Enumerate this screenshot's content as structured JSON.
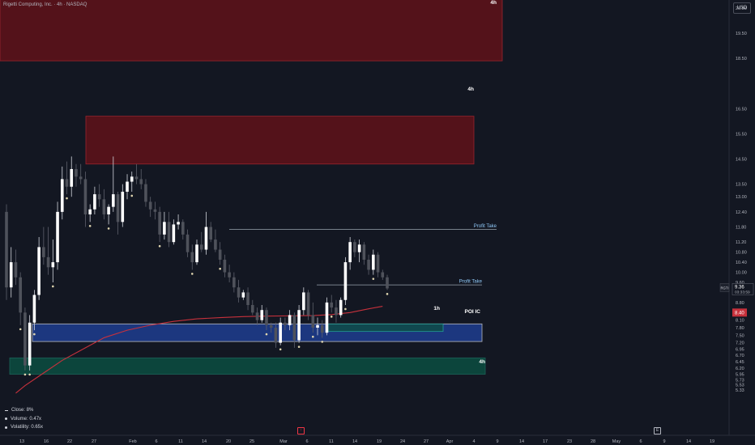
{
  "header": {
    "symbol_line": "Rigetti Computing, Inc. · 4h · NASDAQ",
    "currency_button": "USD"
  },
  "price_axis": {
    "ticks": [
      "20.50",
      "19.50",
      "18.50",
      "16.50",
      "15.50",
      "14.50",
      "13.50",
      "13.00",
      "12.40",
      "11.80",
      "11.20",
      "10.80",
      "10.40",
      "10.00",
      "9.60",
      "8.80",
      "8.40",
      "8.10",
      "7.80",
      "7.50",
      "7.20",
      "6.95",
      "6.70",
      "6.45",
      "6.20",
      "5.95",
      "5.73",
      "5.53",
      "5.33"
    ],
    "last_price_ticker": "RGTI",
    "last_price": "9.36",
    "countdown": "03:33:59",
    "ma_value": "8.40"
  },
  "time_axis": {
    "labels": [
      "13",
      "16",
      "22",
      "27",
      "Feb",
      "6",
      "11",
      "14",
      "20",
      "25",
      "Mar",
      "6",
      "11",
      "14",
      "19",
      "24",
      "27",
      "Apr",
      "4",
      "9",
      "14",
      "17",
      "23",
      "28",
      "May",
      "6",
      "9",
      "14",
      "19"
    ]
  },
  "zones": [
    {
      "label": "4h",
      "color": "#801922"
    },
    {
      "label": "4h",
      "color": "#801922"
    },
    {
      "label": "1h",
      "color": "#0e4f4f"
    },
    {
      "label": "POI IC",
      "color": "#1a2f7a"
    },
    {
      "label": "4h",
      "color": "#0e4f44"
    }
  ],
  "levels": [
    {
      "label": "Profit Take",
      "color": "#9fb3c8"
    },
    {
      "label": "Profit Take",
      "color": "#9fb3c8"
    }
  ],
  "legend_stats": [
    {
      "label": "Close: 8%"
    },
    {
      "label": "Volume: 0.47x"
    },
    {
      "label": "Volatility: 0.65x"
    }
  ],
  "chart_data": {
    "type": "candlestick",
    "symbol": "Rigetti Computing, Inc.",
    "interval": "4h",
    "exchange": "NASDAQ",
    "ylim": [
      5.2,
      21.0
    ],
    "candles": [
      {
        "o": 12.4,
        "h": 12.7,
        "l": 8.9,
        "c": 9.4
      },
      {
        "o": 9.4,
        "h": 11.0,
        "l": 9.0,
        "c": 10.4
      },
      {
        "o": 10.4,
        "h": 10.9,
        "l": 9.5,
        "c": 9.8
      },
      {
        "o": 9.8,
        "h": 10.0,
        "l": 7.9,
        "c": 8.4
      },
      {
        "o": 8.4,
        "h": 8.6,
        "l": 6.1,
        "c": 6.3
      },
      {
        "o": 6.3,
        "h": 8.3,
        "l": 6.1,
        "c": 8.0
      },
      {
        "o": 8.0,
        "h": 9.3,
        "l": 7.7,
        "c": 9.1
      },
      {
        "o": 9.1,
        "h": 11.4,
        "l": 8.9,
        "c": 11.0
      },
      {
        "o": 11.0,
        "h": 11.8,
        "l": 10.3,
        "c": 10.6
      },
      {
        "o": 10.6,
        "h": 11.8,
        "l": 9.9,
        "c": 10.2
      },
      {
        "o": 10.2,
        "h": 11.3,
        "l": 9.6,
        "c": 10.4
      },
      {
        "o": 10.4,
        "h": 12.8,
        "l": 10.1,
        "c": 12.4
      },
      {
        "o": 12.4,
        "h": 14.2,
        "l": 12.1,
        "c": 13.7
      },
      {
        "o": 13.7,
        "h": 14.4,
        "l": 13.1,
        "c": 13.4
      },
      {
        "o": 13.4,
        "h": 14.6,
        "l": 13.0,
        "c": 14.1
      },
      {
        "o": 14.1,
        "h": 14.3,
        "l": 13.4,
        "c": 13.8
      },
      {
        "o": 13.8,
        "h": 14.3,
        "l": 13.5,
        "c": 13.7
      },
      {
        "o": 13.7,
        "h": 14.0,
        "l": 11.8,
        "c": 12.3
      },
      {
        "o": 12.3,
        "h": 12.7,
        "l": 12.0,
        "c": 12.5
      },
      {
        "o": 12.5,
        "h": 13.4,
        "l": 12.3,
        "c": 13.1
      },
      {
        "o": 13.1,
        "h": 13.5,
        "l": 12.6,
        "c": 12.9
      },
      {
        "o": 12.9,
        "h": 13.3,
        "l": 12.1,
        "c": 12.3
      },
      {
        "o": 12.3,
        "h": 12.7,
        "l": 11.9,
        "c": 12.6
      },
      {
        "o": 12.6,
        "h": 14.6,
        "l": 12.4,
        "c": 13.1
      },
      {
        "o": 13.1,
        "h": 13.2,
        "l": 11.5,
        "c": 12.0
      },
      {
        "o": 12.0,
        "h": 13.5,
        "l": 11.8,
        "c": 13.2
      },
      {
        "o": 13.2,
        "h": 13.9,
        "l": 12.9,
        "c": 13.6
      },
      {
        "o": 13.6,
        "h": 14.0,
        "l": 13.2,
        "c": 13.8
      },
      {
        "o": 13.8,
        "h": 14.3,
        "l": 13.5,
        "c": 13.7
      },
      {
        "o": 13.7,
        "h": 14.1,
        "l": 13.3,
        "c": 13.5
      },
      {
        "o": 13.5,
        "h": 13.7,
        "l": 12.6,
        "c": 12.8
      },
      {
        "o": 12.8,
        "h": 13.0,
        "l": 12.2,
        "c": 12.5
      },
      {
        "o": 12.5,
        "h": 12.8,
        "l": 12.1,
        "c": 12.4
      },
      {
        "o": 12.4,
        "h": 12.6,
        "l": 11.2,
        "c": 11.5
      },
      {
        "o": 11.5,
        "h": 12.4,
        "l": 11.3,
        "c": 12.0
      },
      {
        "o": 12.0,
        "h": 12.4,
        "l": 11.0,
        "c": 11.2
      },
      {
        "o": 11.2,
        "h": 12.1,
        "l": 11.1,
        "c": 11.9
      },
      {
        "o": 11.9,
        "h": 12.3,
        "l": 11.7,
        "c": 12.0
      },
      {
        "o": 12.0,
        "h": 12.1,
        "l": 11.3,
        "c": 11.5
      },
      {
        "o": 11.5,
        "h": 11.7,
        "l": 10.6,
        "c": 10.8
      },
      {
        "o": 10.8,
        "h": 11.1,
        "l": 10.1,
        "c": 10.4
      },
      {
        "o": 10.4,
        "h": 11.3,
        "l": 10.3,
        "c": 11.1
      },
      {
        "o": 11.1,
        "h": 11.6,
        "l": 10.8,
        "c": 10.9
      },
      {
        "o": 10.9,
        "h": 12.4,
        "l": 10.7,
        "c": 11.8
      },
      {
        "o": 11.8,
        "h": 12.0,
        "l": 11.2,
        "c": 11.3
      },
      {
        "o": 11.3,
        "h": 11.7,
        "l": 10.8,
        "c": 10.9
      },
      {
        "o": 10.9,
        "h": 11.2,
        "l": 10.3,
        "c": 10.5
      },
      {
        "o": 10.5,
        "h": 10.7,
        "l": 9.8,
        "c": 10.0
      },
      {
        "o": 10.0,
        "h": 10.3,
        "l": 9.6,
        "c": 9.8
      },
      {
        "o": 9.8,
        "h": 10.0,
        "l": 9.2,
        "c": 9.4
      },
      {
        "o": 9.4,
        "h": 9.7,
        "l": 8.8,
        "c": 9.0
      },
      {
        "o": 9.0,
        "h": 9.3,
        "l": 8.9,
        "c": 9.2
      },
      {
        "o": 9.2,
        "h": 9.4,
        "l": 8.5,
        "c": 8.7
      },
      {
        "o": 8.7,
        "h": 8.9,
        "l": 8.3,
        "c": 8.4
      },
      {
        "o": 8.4,
        "h": 8.6,
        "l": 7.9,
        "c": 8.1
      },
      {
        "o": 8.1,
        "h": 8.7,
        "l": 8.0,
        "c": 8.5
      },
      {
        "o": 8.5,
        "h": 8.6,
        "l": 7.7,
        "c": 7.9
      },
      {
        "o": 7.9,
        "h": 8.0,
        "l": 7.6,
        "c": 7.8
      },
      {
        "o": 7.8,
        "h": 8.0,
        "l": 7.0,
        "c": 7.2
      },
      {
        "o": 7.2,
        "h": 8.2,
        "l": 7.1,
        "c": 8.0
      },
      {
        "o": 8.0,
        "h": 8.2,
        "l": 7.7,
        "c": 7.9
      },
      {
        "o": 7.9,
        "h": 8.5,
        "l": 7.7,
        "c": 8.3
      },
      {
        "o": 8.3,
        "h": 8.4,
        "l": 7.0,
        "c": 7.3
      },
      {
        "o": 7.3,
        "h": 8.7,
        "l": 7.2,
        "c": 8.5
      },
      {
        "o": 8.5,
        "h": 9.4,
        "l": 8.3,
        "c": 9.2
      },
      {
        "o": 9.2,
        "h": 9.3,
        "l": 8.1,
        "c": 8.3
      },
      {
        "o": 8.3,
        "h": 8.8,
        "l": 7.6,
        "c": 7.8
      },
      {
        "o": 7.8,
        "h": 8.2,
        "l": 7.5,
        "c": 7.9
      },
      {
        "o": 7.9,
        "h": 8.1,
        "l": 7.4,
        "c": 7.6
      },
      {
        "o": 7.6,
        "h": 9.0,
        "l": 7.5,
        "c": 8.8
      },
      {
        "o": 8.8,
        "h": 9.1,
        "l": 8.4,
        "c": 8.6
      },
      {
        "o": 8.6,
        "h": 8.9,
        "l": 8.0,
        "c": 8.3
      },
      {
        "o": 8.3,
        "h": 9.0,
        "l": 8.2,
        "c": 8.9
      },
      {
        "o": 8.9,
        "h": 10.6,
        "l": 8.7,
        "c": 10.4
      },
      {
        "o": 10.4,
        "h": 11.4,
        "l": 10.1,
        "c": 11.2
      },
      {
        "o": 11.2,
        "h": 11.3,
        "l": 10.6,
        "c": 10.8
      },
      {
        "o": 10.8,
        "h": 11.3,
        "l": 10.4,
        "c": 11.1
      },
      {
        "o": 11.1,
        "h": 11.2,
        "l": 10.3,
        "c": 10.5
      },
      {
        "o": 10.5,
        "h": 10.7,
        "l": 9.9,
        "c": 10.1
      },
      {
        "o": 10.1,
        "h": 10.9,
        "l": 9.9,
        "c": 10.7
      },
      {
        "o": 10.7,
        "h": 10.8,
        "l": 9.8,
        "c": 10.0
      },
      {
        "o": 10.0,
        "h": 10.1,
        "l": 9.7,
        "c": 9.8
      },
      {
        "o": 9.8,
        "h": 9.9,
        "l": 9.3,
        "c": 9.36
      }
    ],
    "moving_average": {
      "color": "#c7313c",
      "points": [
        [
          5.2,
          2
        ],
        [
          5.5,
          4
        ],
        [
          6.0,
          8
        ],
        [
          6.5,
          12
        ],
        [
          7.0,
          17
        ],
        [
          7.4,
          21
        ],
        [
          7.7,
          26
        ],
        [
          7.9,
          31
        ],
        [
          8.05,
          36
        ],
        [
          8.15,
          41
        ],
        [
          8.2,
          46
        ],
        [
          8.24,
          51
        ],
        [
          8.26,
          56
        ],
        [
          8.27,
          61
        ],
        [
          8.28,
          66
        ],
        [
          8.32,
          70
        ],
        [
          8.4,
          74
        ],
        [
          8.55,
          78
        ],
        [
          8.65,
          81
        ]
      ]
    },
    "zones": [
      {
        "label": "4h",
        "top": 21.0,
        "bottom": 18.4,
        "color": "#801922"
      },
      {
        "label": "4h",
        "top": 16.2,
        "bottom": 14.3,
        "color": "#801922"
      },
      {
        "label": "POI IC",
        "top": 7.95,
        "bottom": 7.25,
        "color": "#1a2f7a"
      },
      {
        "label": "1h",
        "top": 7.95,
        "bottom": 7.65,
        "color": "#0e4f4f"
      },
      {
        "label": "4h",
        "top": 6.6,
        "bottom": 5.95,
        "color": "#0e4f44"
      }
    ],
    "levels": [
      {
        "label": "Profit Take",
        "price": 11.7
      },
      {
        "label": "Profit Take",
        "price": 9.5
      }
    ],
    "last_price": 9.36
  }
}
